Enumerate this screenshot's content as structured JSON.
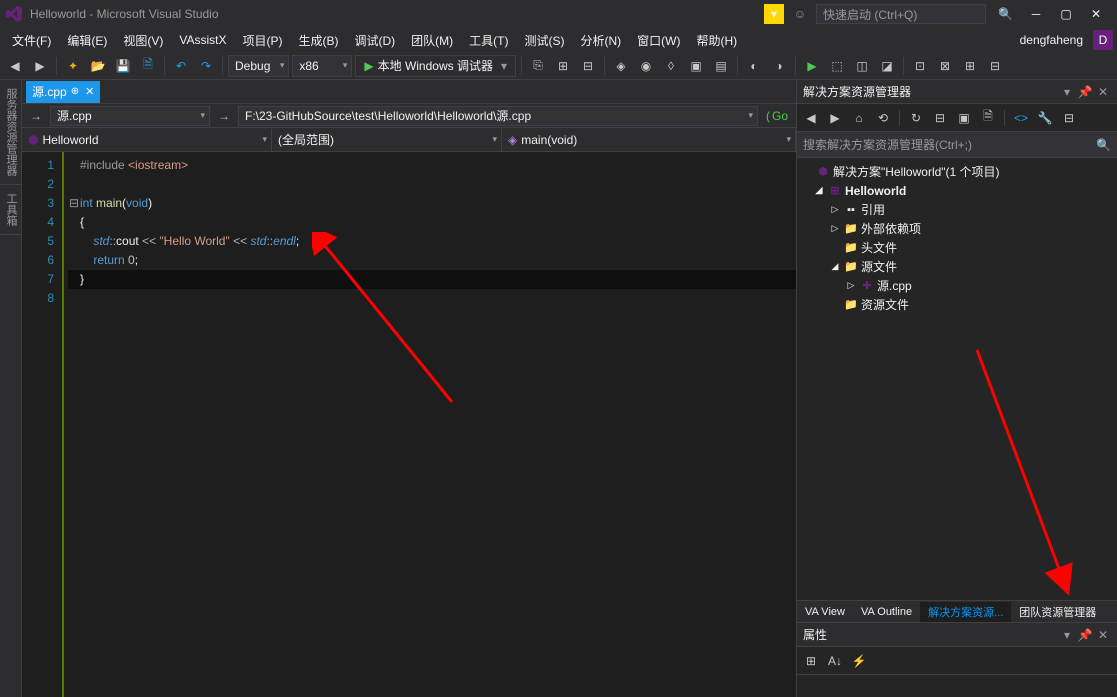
{
  "titlebar": {
    "title": "Helloworld - Microsoft Visual Studio",
    "quick_launch_placeholder": "快速启动 (Ctrl+Q)"
  },
  "menubar": {
    "items": [
      "文件(F)",
      "编辑(E)",
      "视图(V)",
      "VAssistX",
      "项目(P)",
      "生成(B)",
      "调试(D)",
      "团队(M)",
      "工具(T)",
      "测试(S)",
      "分析(N)",
      "窗口(W)",
      "帮助(H)"
    ],
    "user": "dengfaheng",
    "avatar_initial": "D"
  },
  "toolbar": {
    "config": "Debug",
    "platform": "x86",
    "run_label": "本地 Windows 调试器"
  },
  "left_vertical_tabs": [
    "服务器资源管理器",
    "工具箱"
  ],
  "editor": {
    "tab_name": "源.cpp",
    "nav_file": "源.cpp",
    "nav_path": "F:\\23-GitHubSource\\test\\Helloworld\\Helloworld\\源.cpp",
    "go_label": "Go",
    "scope_project": "Helloworld",
    "scope_global": "(全局范围)",
    "scope_func": "main(void)",
    "line_numbers": [
      "1",
      "2",
      "3",
      "4",
      "5",
      "6",
      "7",
      "8"
    ],
    "code": {
      "l1_include": "#include",
      "l1_file": "<iostream>",
      "l3_int": "int",
      "l3_main": "main",
      "l3_void": "void",
      "l5_std": "std",
      "l5_cout": "cout",
      "l5_str": "\"Hello World\"",
      "l5_endl": "endl",
      "l6_return": "return",
      "l6_zero": "0"
    }
  },
  "solution_explorer": {
    "title": "解决方案资源管理器",
    "search_placeholder": "搜索解决方案资源管理器(Ctrl+;)",
    "solution_label": "解决方案\"Helloworld\"(1 个项目)",
    "project": "Helloworld",
    "refs": "引用",
    "external": "外部依赖项",
    "headers": "头文件",
    "sources": "源文件",
    "source_file": "源.cpp",
    "resources": "资源文件"
  },
  "bottom_tabs": [
    "VA View",
    "VA Outline",
    "解决方案资源...",
    "团队资源管理器"
  ],
  "props": {
    "title": "属性"
  }
}
